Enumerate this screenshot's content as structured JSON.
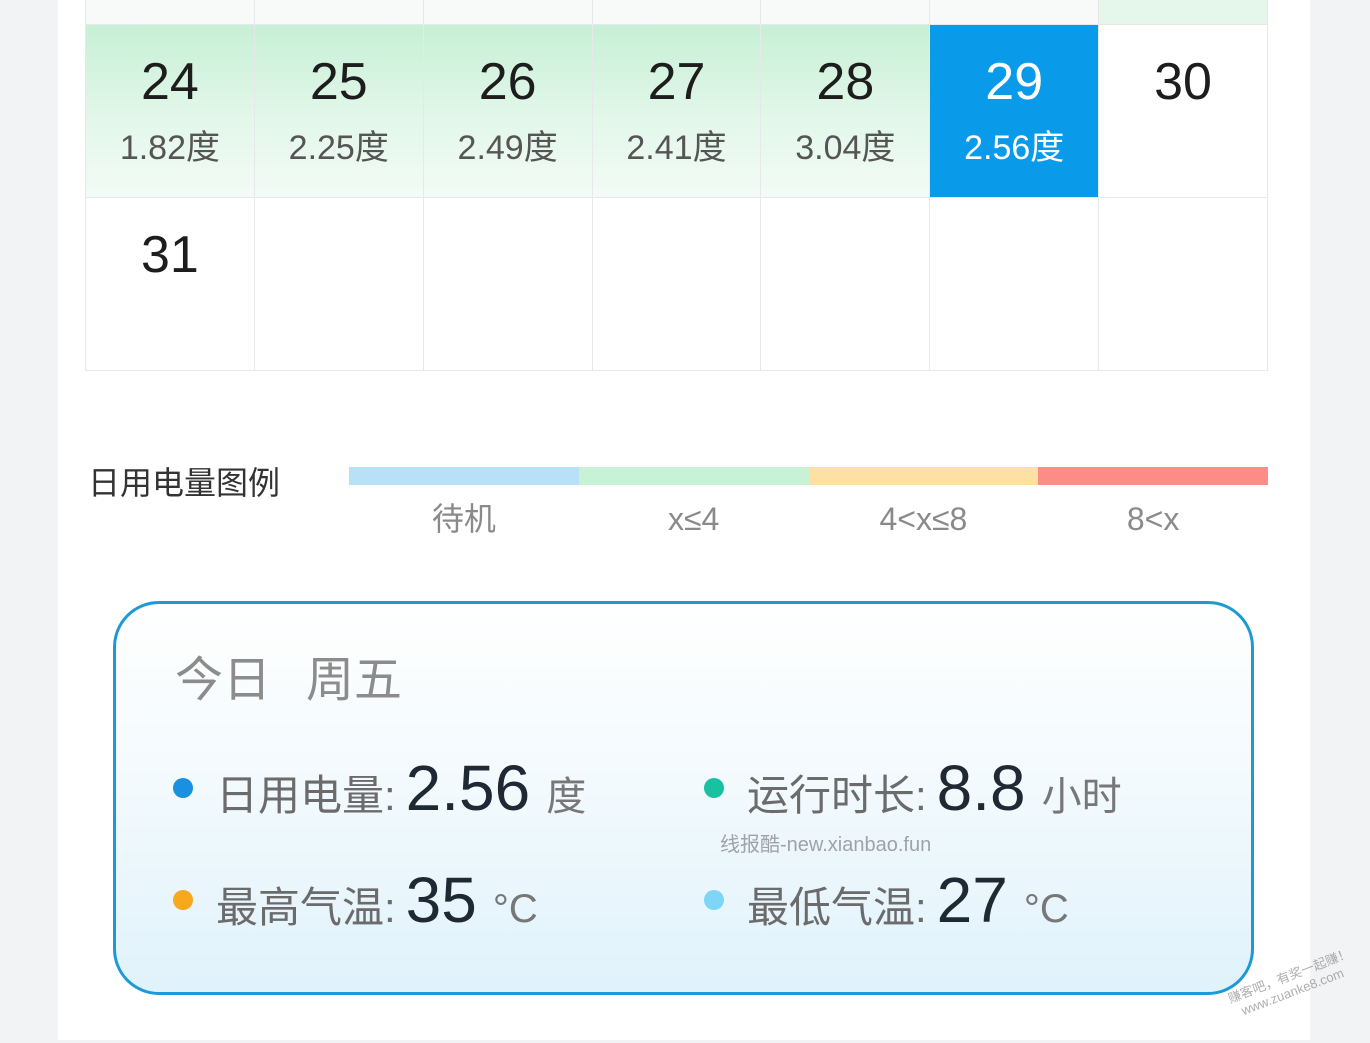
{
  "theme": {
    "selected": "#0a9aea",
    "usage-top": "#c7f0d5",
    "grid-line": "#e6e8eb",
    "card-border": "#1d9ad5"
  },
  "calendar": {
    "week_a": [
      {
        "day": "24",
        "usage": "1.82度"
      },
      {
        "day": "25",
        "usage": "2.25度"
      },
      {
        "day": "26",
        "usage": "2.49度"
      },
      {
        "day": "27",
        "usage": "2.41度"
      },
      {
        "day": "28",
        "usage": "3.04度"
      },
      {
        "day": "29",
        "usage": "2.56度",
        "selected": true
      },
      {
        "day": "30"
      }
    ],
    "week_b": [
      {
        "day": "31"
      }
    ]
  },
  "legend": {
    "title": "日用电量图例",
    "items": [
      {
        "label": "待机",
        "color": "#b8e1f8"
      },
      {
        "label": "x≤4",
        "color": "#c8f2d5"
      },
      {
        "label": "4<x≤8",
        "color": "#fde0a3"
      },
      {
        "label": "8<x",
        "color": "#fb8d86"
      }
    ]
  },
  "today": {
    "day_label": "今日",
    "weekday": "周五",
    "stats": [
      {
        "label": "日用电量:",
        "value": "2.56",
        "unit": "度",
        "dot_color": "#1a90e2"
      },
      {
        "label": "运行时长:",
        "value": "8.8",
        "unit": "小时",
        "dot_color": "#17c1a2"
      },
      {
        "label": "最高气温:",
        "value": "35",
        "unit": "°C",
        "dot_color": "#f7a81d"
      },
      {
        "label": "最低气温:",
        "value": "27",
        "unit": "°C",
        "dot_color": "#7fd5f8"
      }
    ]
  },
  "watermarks": {
    "center": "线报酷-new.xianbao.fun",
    "corner_line1": "赚客吧，有奖一起赚！",
    "corner_line2": "www.zuanke8.com"
  }
}
